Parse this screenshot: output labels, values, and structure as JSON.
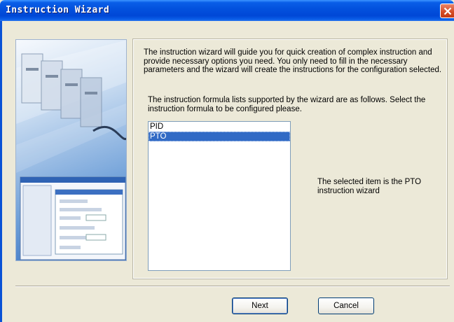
{
  "window": {
    "title": "Instruction Wizard"
  },
  "intro_text": "The instruction wizard will guide you for quick creation of complex instruction and provide necessary options you need. You only need to fill in the necessary parameters and the wizard will create the instructions for the configuration selected.",
  "formula_text": "The instruction formula lists supported by the wizard are as follows. Select the instruction formula to be configured please.",
  "list": {
    "items": [
      "PID",
      "PTO"
    ],
    "selected": "PTO"
  },
  "description": "The selected item is the PTO instruction wizard",
  "buttons": {
    "next": "Next",
    "cancel": "Cancel"
  },
  "colors": {
    "titlebar": "#0352de",
    "selection": "#316ac5",
    "dialog_bg": "#ece9d8",
    "close_button": "#d54a24"
  },
  "icons": {
    "close": "close-icon"
  }
}
